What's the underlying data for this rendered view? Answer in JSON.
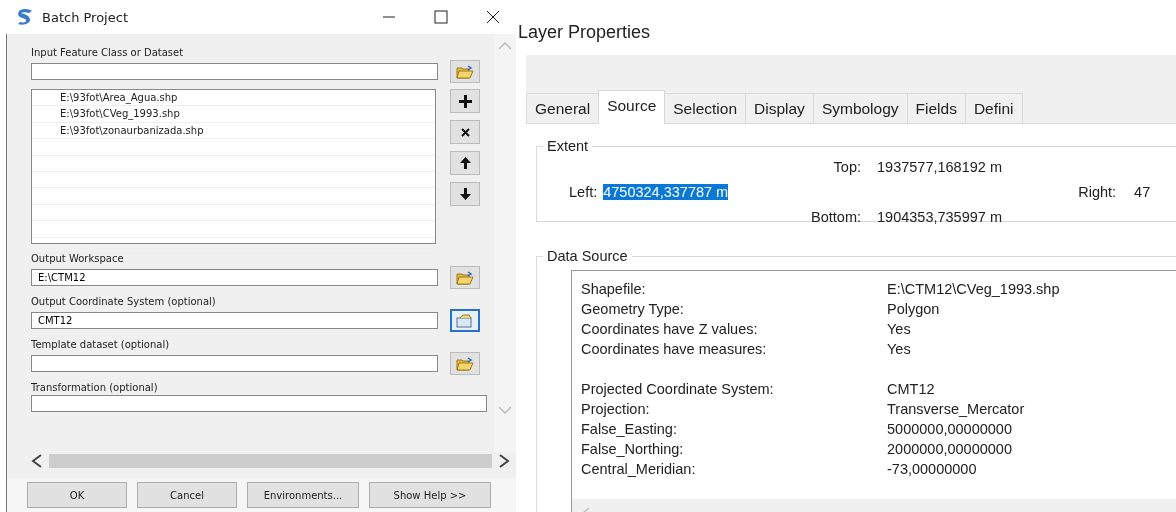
{
  "batch_dialog": {
    "title": "Batch Project",
    "fields": [
      {
        "kind": "folder-path",
        "label": "Input Feature Class or Dataset",
        "button_focused": false
      },
      {
        "kind": "list",
        "items": [
          "E:\\93fot\\Area_Agua.shp",
          "E:\\93fot\\CVeg_1993.shp",
          "E:\\93fot\\zonaurbanizada.shp"
        ]
      },
      {
        "kind": "folder-path",
        "label": "Output Workspace",
        "value": "E:\\CTM12",
        "button_focused": false
      },
      {
        "kind": "coordinate-path",
        "label": "Output Coordinate System (optional)",
        "value": "CMT12",
        "button_focused": true
      },
      {
        "kind": "folder-path",
        "label": "Template dataset (optional)",
        "button_focused": false
      },
      {
        "kind": "text",
        "label": "Transformation (optional)"
      }
    ],
    "buttons": [
      "OK",
      "Cancel",
      "Environments...",
      "Show Help >>"
    ]
  },
  "layer_properties": {
    "title": "Layer Properties",
    "tabs": [
      {
        "label": "General",
        "selected": false
      },
      {
        "label": "Source",
        "selected": true
      },
      {
        "label": "Selection",
        "selected": false
      },
      {
        "label": "Display",
        "selected": false
      },
      {
        "label": "Symbology",
        "selected": false
      },
      {
        "label": "Fields",
        "selected": false
      },
      {
        "label": "Defini",
        "selected": false
      }
    ],
    "extent": {
      "title": "Extent",
      "top_label": "Top:",
      "top_value": "1937577,168192 m",
      "left_label": "Left:",
      "left_value": "4750324,337787 m",
      "left_value_selected": true,
      "right_label": "Right:",
      "right_value": "47",
      "bottom_label": "Bottom:",
      "bottom_value": "1904353,735997 m"
    },
    "data_source": {
      "title": "Data Source",
      "sections": [
        {
          "rows": [
            {
              "label": "Shapefile:",
              "value": "E:\\CTM12\\CVeg_1993.shp"
            },
            {
              "label": "Geometry Type:",
              "value": "Polygon"
            },
            {
              "label": "Coordinates have Z values:",
              "value": "Yes"
            },
            {
              "label": "Coordinates have measures:",
              "value": "Yes"
            }
          ]
        },
        {
          "rows": [
            {
              "label": "Projected Coordinate System:",
              "value": "CMT12"
            },
            {
              "label": "Projection:",
              "value": "Transverse_Mercator"
            },
            {
              "label": "False_Easting:",
              "value": "5000000,00000000"
            },
            {
              "label": "False_Northing:",
              "value": "2000000,00000000"
            },
            {
              "label": "Central_Meridian:",
              "value": "-73,00000000"
            }
          ]
        }
      ]
    }
  }
}
